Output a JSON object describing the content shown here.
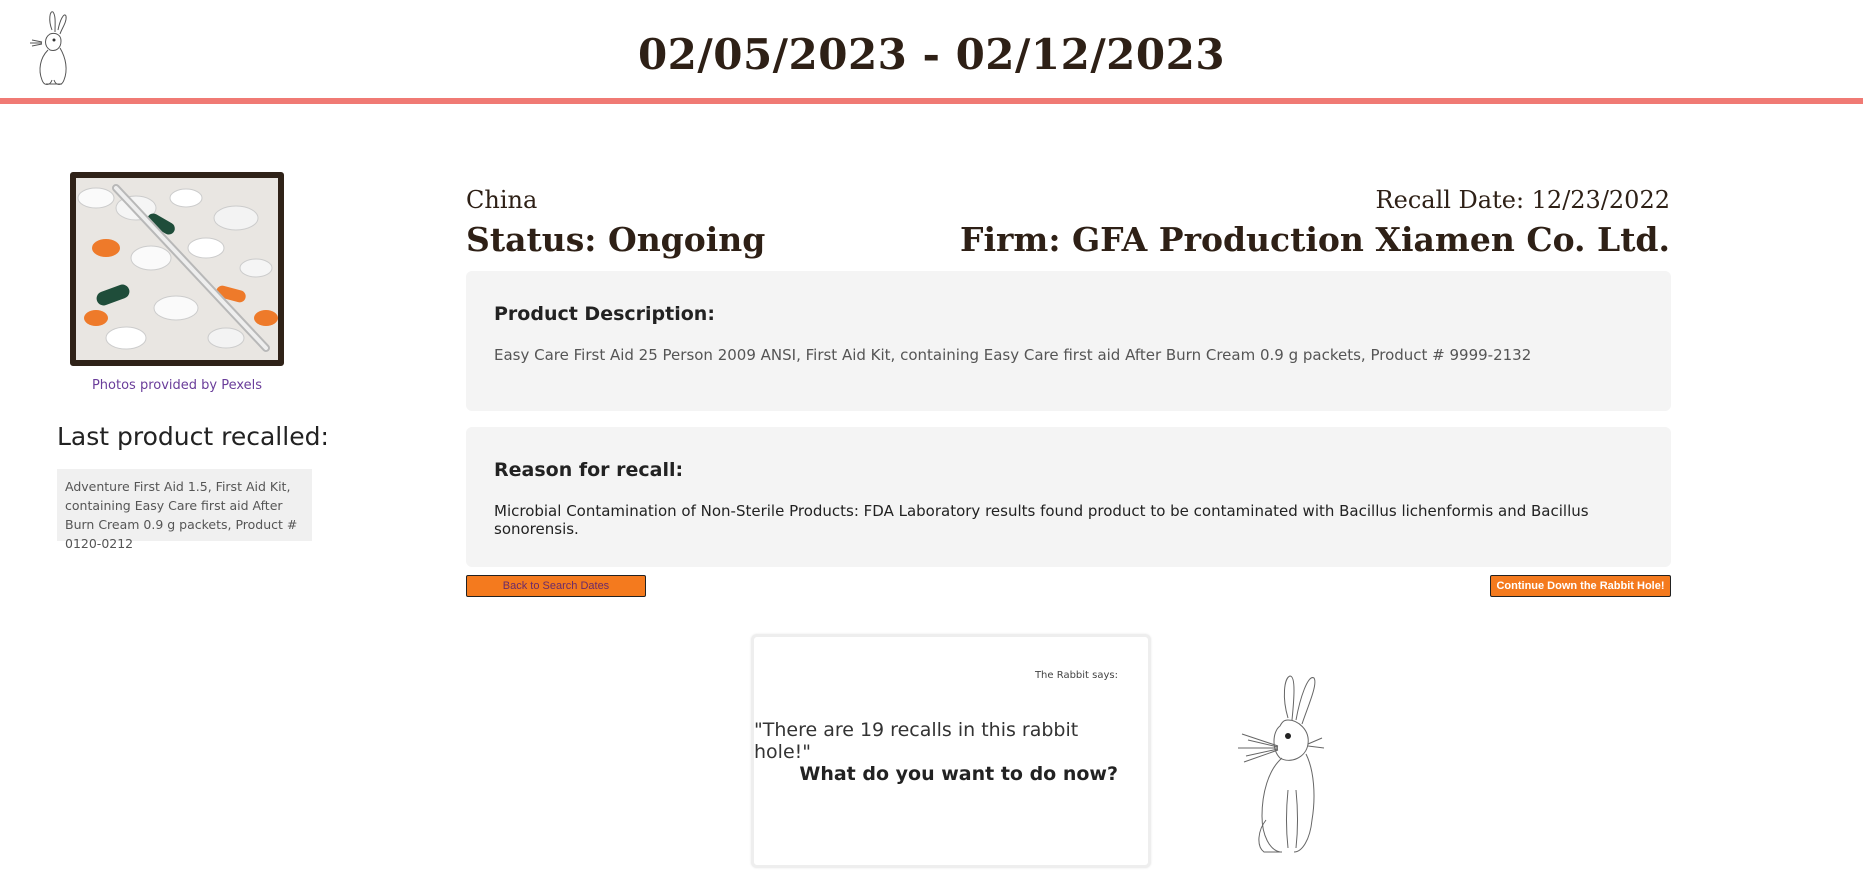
{
  "header": {
    "title": "02/05/2023 - 02/12/2023"
  },
  "sidebar": {
    "photo_credit": "Photos provided by Pexels",
    "last_title": "Last product recalled:",
    "last_product": "Adventure First Aid 1.5, First Aid Kit, containing Easy Care first aid After Burn Cream 0.9 g packets, Product # 0120-0212"
  },
  "recall": {
    "country": "China",
    "status": "Status: Ongoing",
    "recall_date": "Recall Date: 12/23/2022",
    "firm": "Firm: GFA Production Xiamen Co. Ltd.",
    "description_title": "Product Description:",
    "description": "Easy Care First Aid 25 Person 2009 ANSI, First Aid Kit, containing Easy Care first aid After Burn Cream 0.9 g packets, Product # 9999-2132",
    "reason_title": "Reason for recall:",
    "reason": "Microbial Contamination of Non-Sterile Products: FDA Laboratory results found product to be contaminated with Bacillus lichenformis and Bacillus sonorensis."
  },
  "buttons": {
    "back": "Back to Search Dates",
    "continue": "Continue Down the Rabbit Hole!"
  },
  "rabbit": {
    "label": "The Rabbit says:",
    "quote": "\"There are 19 recalls in this rabbit hole!\"",
    "question": "What do you want to do now?"
  },
  "colors": {
    "accent_line": "#f07a74",
    "button": "#f47a1e",
    "heading": "#2e2016",
    "card_bg": "#f4f4f4"
  },
  "icons": {
    "logo": "rabbit-logo-icon",
    "mascot": "rabbit-illustration-icon"
  }
}
